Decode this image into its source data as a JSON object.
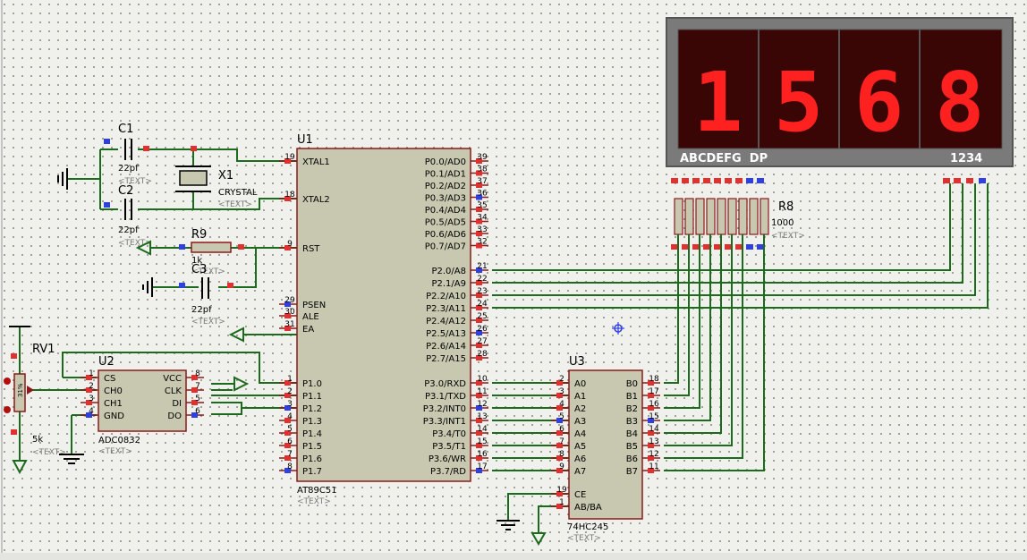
{
  "display": {
    "digits": [
      "1",
      "5",
      "6",
      "8"
    ],
    "segment_label": "ABCDEFG  DP",
    "digit_label": "1234"
  },
  "u1": {
    "ref": "U1",
    "part": "AT89C51",
    "text": "<TEXT>",
    "left_pins": [
      {
        "num": "19",
        "name": "XTAL1"
      },
      {
        "num": "18",
        "name": "XTAL2"
      },
      {
        "num": "9",
        "name": "RST"
      },
      {
        "num": "29",
        "name": "PSEN"
      },
      {
        "num": "30",
        "name": "ALE"
      },
      {
        "num": "31",
        "name": "EA"
      },
      {
        "num": "1",
        "name": "P1.0"
      },
      {
        "num": "2",
        "name": "P1.1"
      },
      {
        "num": "3",
        "name": "P1.2"
      },
      {
        "num": "4",
        "name": "P1.3"
      },
      {
        "num": "5",
        "name": "P1.4"
      },
      {
        "num": "6",
        "name": "P1.5"
      },
      {
        "num": "7",
        "name": "P1.6"
      },
      {
        "num": "8",
        "name": "P1.7"
      }
    ],
    "right_pins": [
      {
        "num": "39",
        "name": "P0.0/AD0"
      },
      {
        "num": "38",
        "name": "P0.1/AD1"
      },
      {
        "num": "37",
        "name": "P0.2/AD2"
      },
      {
        "num": "36",
        "name": "P0.3/AD3"
      },
      {
        "num": "35",
        "name": "P0.4/AD4"
      },
      {
        "num": "34",
        "name": "P0.5/AD5"
      },
      {
        "num": "33",
        "name": "P0.6/AD6"
      },
      {
        "num": "32",
        "name": "P0.7/AD7"
      },
      {
        "num": "21",
        "name": "P2.0/A8"
      },
      {
        "num": "22",
        "name": "P2.1/A9"
      },
      {
        "num": "23",
        "name": "P2.2/A10"
      },
      {
        "num": "24",
        "name": "P2.3/A11"
      },
      {
        "num": "25",
        "name": "P2.4/A12"
      },
      {
        "num": "26",
        "name": "P2.5/A13"
      },
      {
        "num": "27",
        "name": "P2.6/A14"
      },
      {
        "num": "28",
        "name": "P2.7/A15"
      },
      {
        "num": "10",
        "name": "P3.0/RXD"
      },
      {
        "num": "11",
        "name": "P3.1/TXD"
      },
      {
        "num": "12",
        "name": "P3.2/INT0"
      },
      {
        "num": "13",
        "name": "P3.3/INT1"
      },
      {
        "num": "14",
        "name": "P3.4/T0"
      },
      {
        "num": "15",
        "name": "P3.5/T1"
      },
      {
        "num": "16",
        "name": "P3.6/WR"
      },
      {
        "num": "17",
        "name": "P3.7/RD"
      }
    ]
  },
  "u2": {
    "ref": "U2",
    "part": "ADC0832",
    "text": "<TEXT>",
    "left_pins": [
      {
        "num": "1",
        "name": "CS"
      },
      {
        "num": "2",
        "name": "CH0"
      },
      {
        "num": "3",
        "name": "CH1"
      },
      {
        "num": "4",
        "name": "GND"
      }
    ],
    "right_pins": [
      {
        "num": "8",
        "name": "VCC"
      },
      {
        "num": "7",
        "name": "CLK"
      },
      {
        "num": "5",
        "name": "DI"
      },
      {
        "num": "6",
        "name": "DO"
      }
    ]
  },
  "u3": {
    "ref": "U3",
    "part": "74HC245",
    "text": "<TEXT>",
    "left_pins": [
      {
        "num": "2",
        "name": "A0"
      },
      {
        "num": "3",
        "name": "A1"
      },
      {
        "num": "4",
        "name": "A2"
      },
      {
        "num": "5",
        "name": "A3"
      },
      {
        "num": "6",
        "name": "A4"
      },
      {
        "num": "7",
        "name": "A5"
      },
      {
        "num": "8",
        "name": "A6"
      },
      {
        "num": "9",
        "name": "A7"
      }
    ],
    "ctrl_pins": [
      {
        "num": "19",
        "name": "CE"
      },
      {
        "num": "1",
        "name": "AB/BA"
      }
    ],
    "right_pins": [
      {
        "num": "18",
        "name": "B0"
      },
      {
        "num": "17",
        "name": "B1"
      },
      {
        "num": "16",
        "name": "B2"
      },
      {
        "num": "15",
        "name": "B3"
      },
      {
        "num": "14",
        "name": "B4"
      },
      {
        "num": "13",
        "name": "B5"
      },
      {
        "num": "12",
        "name": "B6"
      },
      {
        "num": "11",
        "name": "B7"
      }
    ]
  },
  "c1": {
    "ref": "C1",
    "value": "22pf",
    "text": "<TEXT>"
  },
  "c2": {
    "ref": "C2",
    "value": "22pf",
    "text": "<TEXT>"
  },
  "c3": {
    "ref": "C3",
    "value": "22pf",
    "text": "<TEXT>"
  },
  "x1": {
    "ref": "X1",
    "value": "CRYSTAL",
    "text": "<TEXT>"
  },
  "r9": {
    "ref": "R9",
    "value": "1k",
    "text": "<TEXT>"
  },
  "r8": {
    "ref": "R8",
    "value": "1000",
    "text": "<TEXT>"
  },
  "rv1": {
    "ref": "RV1",
    "value": "5k",
    "text": "<TEXT>",
    "percent": "31%"
  }
}
